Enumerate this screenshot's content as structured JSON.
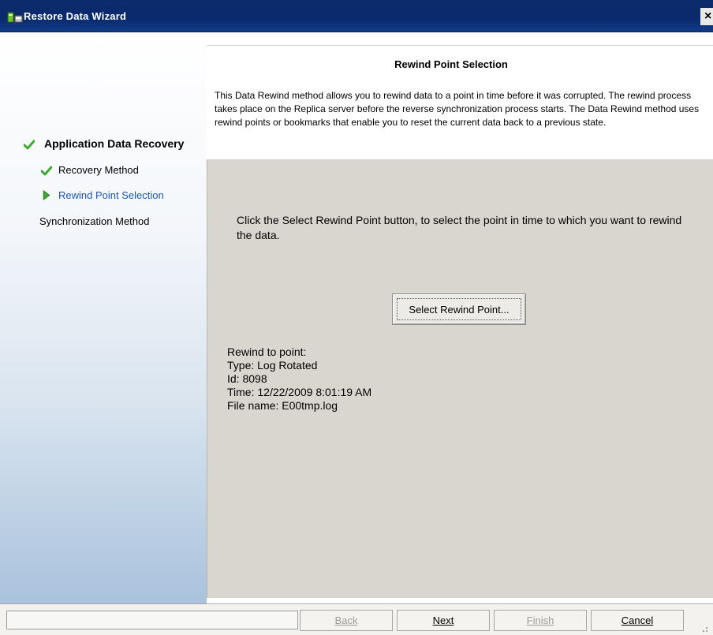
{
  "window": {
    "title": "Restore Data Wizard",
    "close_label": "×"
  },
  "nav": {
    "items": [
      {
        "label": "Application Data Recovery",
        "state": "completed",
        "icon": "green-check-icon"
      },
      {
        "label": "Recovery Method",
        "state": "completed",
        "icon": "green-check-icon"
      },
      {
        "label": "Rewind Point Selection",
        "state": "current",
        "icon": "green-arrow-icon"
      },
      {
        "label": "Synchronization Method",
        "state": "pending",
        "icon": ""
      }
    ]
  },
  "header": {
    "title": "Rewind Point Selection",
    "description": "This Data Rewind method allows you to rewind data to a point in time before it was corrupted. The rewind process takes place on the Replica server before the reverse synchronization process starts. The Data Rewind method uses rewind points or bookmarks that enable you to reset the current data back to a previous state."
  },
  "content": {
    "instruction": "Click the Select Rewind Point button, to select the point in time to which you want to rewind the data.",
    "select_button_label": "Select Rewind Point...",
    "details": {
      "heading": "Rewind to point:",
      "type": "Type: Log Rotated",
      "id": "Id: 8098",
      "time": "Time: 12/22/2009 8:01:19 AM",
      "file": "File name: E00tmp.log"
    }
  },
  "buttons": {
    "back": "Back",
    "next": "Next",
    "finish": "Finish",
    "cancel": "Cancel"
  },
  "colors": {
    "title_bar": "#0c2b6b",
    "current_step": "#1a57b6",
    "check_green": "#3fa832",
    "content_bg": "#d9d6d0"
  }
}
